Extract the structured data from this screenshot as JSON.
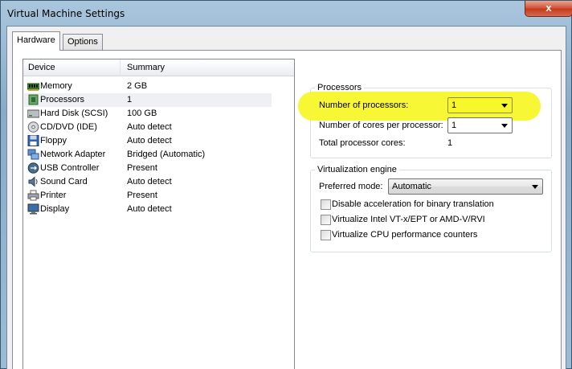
{
  "window": {
    "title": "Virtual Machine Settings",
    "close_label": "x"
  },
  "tabs": [
    {
      "label": "Hardware",
      "active": true
    },
    {
      "label": "Options",
      "active": false
    }
  ],
  "device_list": {
    "columns": [
      "Device",
      "Summary"
    ],
    "rows": [
      {
        "icon": "memory-icon",
        "device": "Memory",
        "summary": "2 GB",
        "selected": false
      },
      {
        "icon": "processor-icon",
        "device": "Processors",
        "summary": "1",
        "selected": true
      },
      {
        "icon": "hard-disk-icon",
        "device": "Hard Disk (SCSI)",
        "summary": "100 GB",
        "selected": false
      },
      {
        "icon": "cd-dvd-icon",
        "device": "CD/DVD (IDE)",
        "summary": "Auto detect",
        "selected": false
      },
      {
        "icon": "floppy-icon",
        "device": "Floppy",
        "summary": "Auto detect",
        "selected": false
      },
      {
        "icon": "network-adapter-icon",
        "device": "Network Adapter",
        "summary": "Bridged (Automatic)",
        "selected": false
      },
      {
        "icon": "usb-icon",
        "device": "USB Controller",
        "summary": "Present",
        "selected": false
      },
      {
        "icon": "sound-card-icon",
        "device": "Sound Card",
        "summary": "Auto detect",
        "selected": false
      },
      {
        "icon": "printer-icon",
        "device": "Printer",
        "summary": "Present",
        "selected": false
      },
      {
        "icon": "display-icon",
        "device": "Display",
        "summary": "Auto detect",
        "selected": false
      }
    ]
  },
  "processors": {
    "legend": "Processors",
    "num_processors_label": "Number of processors:",
    "num_processors_value": "1",
    "cores_label": "Number of cores per processor:",
    "cores_value": "1",
    "total_label": "Total processor cores:",
    "total_value": "1",
    "highlight_color": "#f7f72a"
  },
  "virtualization": {
    "legend": "Virtualization engine",
    "preferred_mode_label": "Preferred mode:",
    "preferred_mode_value": "Automatic",
    "options": [
      {
        "label": "Disable acceleration for binary translation",
        "checked": false
      },
      {
        "label": "Virtualize Intel VT-x/EPT or AMD-V/RVI",
        "checked": false
      },
      {
        "label": "Virtualize CPU performance counters",
        "checked": false
      }
    ]
  }
}
